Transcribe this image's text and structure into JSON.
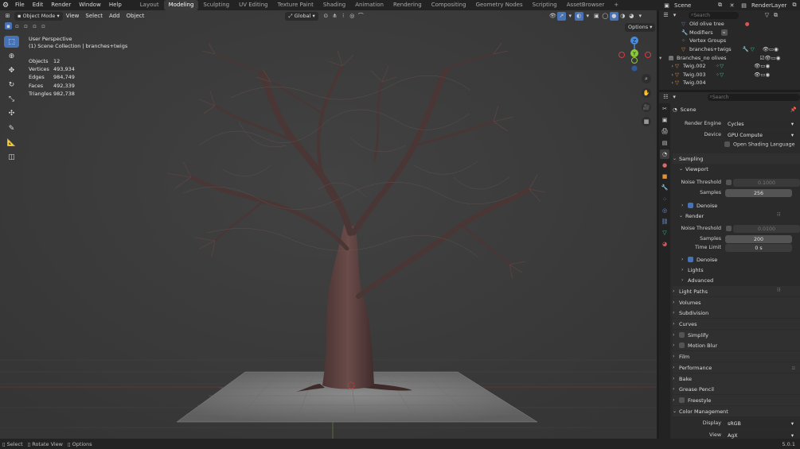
{
  "menu": {
    "items": [
      "File",
      "Edit",
      "Render",
      "Window",
      "Help"
    ],
    "workspaces": [
      "Layout",
      "Modeling",
      "Sculpting",
      "UV Editing",
      "Texture Paint",
      "Shading",
      "Animation",
      "Rendering",
      "Compositing",
      "Geometry Nodes",
      "Scripting",
      "AssetBrowser"
    ],
    "active_workspace": "Modeling",
    "add_tab": "+",
    "scene_name": "Scene",
    "view_layer": "RenderLayer"
  },
  "viewport_header": {
    "mode": "Object Mode",
    "menus": [
      "View",
      "Select",
      "Add",
      "Object"
    ],
    "orientation": "Global",
    "options_label": "Options"
  },
  "viewport_overlay": {
    "perspective": "User Perspective",
    "collection": "(1) Scene Collection | branches+twigs",
    "stats": [
      {
        "label": "Objects",
        "value": "12"
      },
      {
        "label": "Vertices",
        "value": "493,934"
      },
      {
        "label": "Edges",
        "value": "984,749"
      },
      {
        "label": "Faces",
        "value": "492,339"
      },
      {
        "label": "Triangles",
        "value": "982,738"
      }
    ],
    "gizmo_axes": {
      "y": "Y",
      "z": "Z"
    }
  },
  "outliner": {
    "search_placeholder": "Search",
    "rows": [
      {
        "label": "Old olive tree",
        "indent": 3
      },
      {
        "label": "Modifiers",
        "indent": 3
      },
      {
        "label": "Vertex Groups",
        "indent": 3
      },
      {
        "label": "branches+twigs",
        "indent": 3
      },
      {
        "label": "Branches_no olives",
        "indent": 1
      },
      {
        "label": "Twig.002",
        "indent": 2
      },
      {
        "label": "Twig.003",
        "indent": 2
      },
      {
        "label": "Twig.004",
        "indent": 2
      }
    ]
  },
  "properties": {
    "search_placeholder": "Search",
    "context": "Scene",
    "render_engine_label": "Render Engine",
    "render_engine": "Cycles",
    "device_label": "Device",
    "device": "GPU Compute",
    "osl_label": "Open Shading Language",
    "sampling": "Sampling",
    "viewport": "Viewport",
    "noise_threshold_label": "Noise Threshold",
    "viewport_noise": "0.1000",
    "samples_label": "Samples",
    "viewport_samples": "256",
    "denoise": "Denoise",
    "render": "Render",
    "render_noise": "0.0100",
    "render_samples": "200",
    "time_limit_label": "Time Limit",
    "time_limit": "0 s",
    "lights": "Lights",
    "advanced": "Advanced",
    "panels": [
      "Light Paths",
      "Volumes",
      "Subdivision",
      "Curves",
      "Simplify",
      "Motion Blur",
      "Film",
      "Performance",
      "Bake",
      "Grease Pencil",
      "Freestyle",
      "Color Management"
    ],
    "display_label": "Display",
    "display": "sRGB",
    "view_label": "View",
    "view": "AgX"
  },
  "statusbar": {
    "select": "Select",
    "rotate": "Rotate View",
    "options": "Options",
    "version": "5.0.1"
  },
  "colors": {
    "accent": "#4772b3",
    "x_axis": "#d63c4a",
    "y_axis": "#8cc83c",
    "z_axis": "#4d8bd6"
  }
}
